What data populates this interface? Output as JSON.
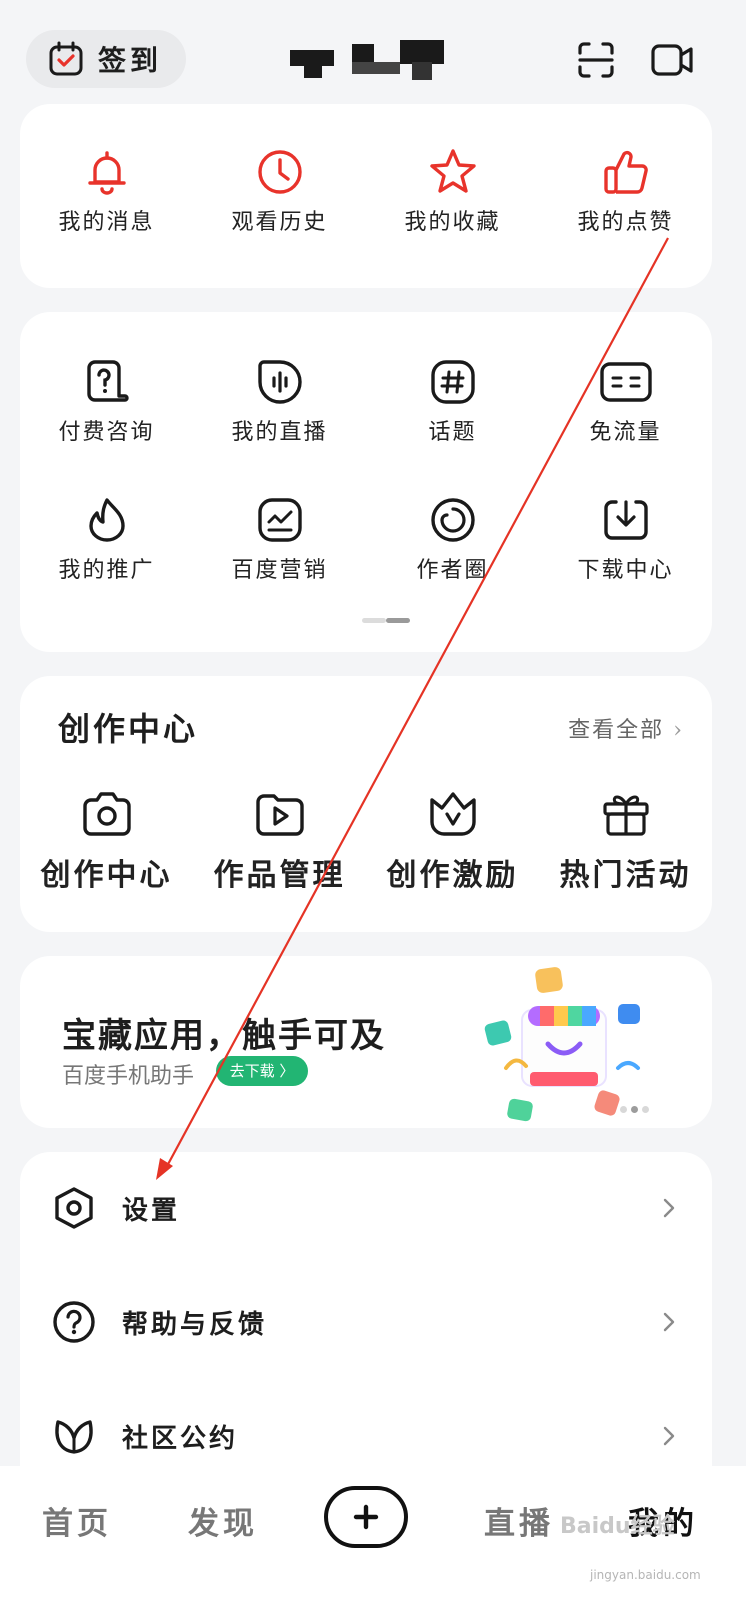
{
  "header": {
    "signin_label": "签到",
    "icons": [
      "calendar-check-icon",
      "scan-icon",
      "video-camera-icon"
    ]
  },
  "quick_actions": [
    {
      "label": "我的消息",
      "icon": "bell-icon"
    },
    {
      "label": "观看历史",
      "icon": "clock-icon"
    },
    {
      "label": "我的收藏",
      "icon": "star-icon"
    },
    {
      "label": "我的点赞",
      "icon": "thumbs-up-icon"
    }
  ],
  "tools": [
    {
      "label": "付费咨询",
      "icon": "paid-consult-icon"
    },
    {
      "label": "我的直播",
      "icon": "live-icon"
    },
    {
      "label": "话题",
      "icon": "hashtag-icon"
    },
    {
      "label": "免流量",
      "icon": "free-data-icon"
    },
    {
      "label": "我的推广",
      "icon": "flame-icon"
    },
    {
      "label": "百度营销",
      "icon": "marketing-icon"
    },
    {
      "label": "作者圈",
      "icon": "author-circle-icon"
    },
    {
      "label": "下载中心",
      "icon": "download-icon"
    }
  ],
  "creation": {
    "title": "创作中心",
    "view_all": "查看全部",
    "items": [
      {
        "label": "创作中心",
        "icon": "camera-icon"
      },
      {
        "label": "作品管理",
        "icon": "play-folder-icon"
      },
      {
        "label": "创作激励",
        "icon": "crown-icon"
      },
      {
        "label": "热门活动",
        "icon": "gift-icon"
      }
    ]
  },
  "banner": {
    "title": "宝藏应用，触手可及",
    "subtitle": "百度手机助手",
    "button": "去下载 〉",
    "page_count": 3,
    "active_page": 2
  },
  "menu": [
    {
      "label": "设置",
      "icon": "settings-hexagon-icon"
    },
    {
      "label": "帮助与反馈",
      "icon": "help-circle-icon"
    },
    {
      "label": "社区公约",
      "icon": "leaf-icon"
    }
  ],
  "tabbar": {
    "items": [
      "首页",
      "发现",
      "直播",
      "我的"
    ],
    "active": "我的",
    "watermark": "Baidu经验",
    "watermark_url": "jingyan.baidu.com"
  },
  "colors": {
    "accent_red": "#e8332b",
    "green": "#22b573",
    "annotation": "#e53325"
  }
}
